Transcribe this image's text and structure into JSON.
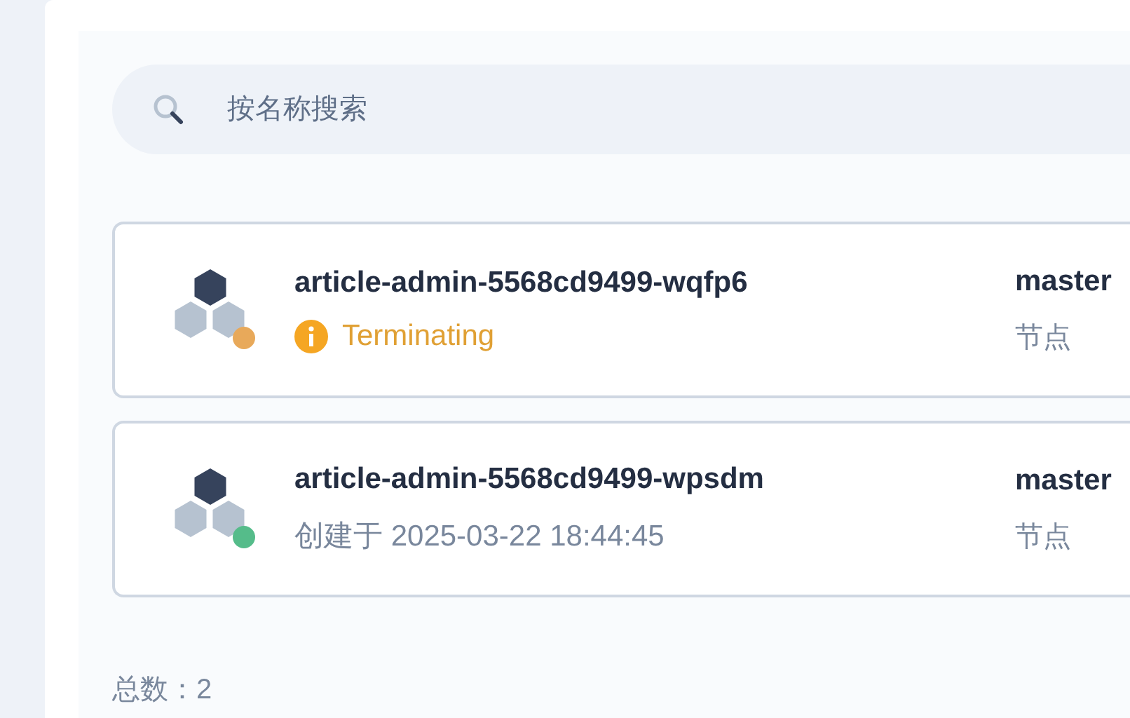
{
  "search": {
    "placeholder": "按名称搜索"
  },
  "pods": [
    {
      "name": "article-admin-5568cd9499-wqfp6",
      "color": "#e8a95a",
      "status": {
        "kind": "warning",
        "text": "Terminating"
      },
      "node": "master",
      "node_label": "节点"
    },
    {
      "name": "article-admin-5568cd9499-wpsdm",
      "color": "#55bc8a",
      "status": {
        "kind": "created",
        "text": "创建于 2025-03-22 18:44:45"
      },
      "node": "master",
      "node_label": "节点"
    }
  ],
  "total": "总数：2"
}
